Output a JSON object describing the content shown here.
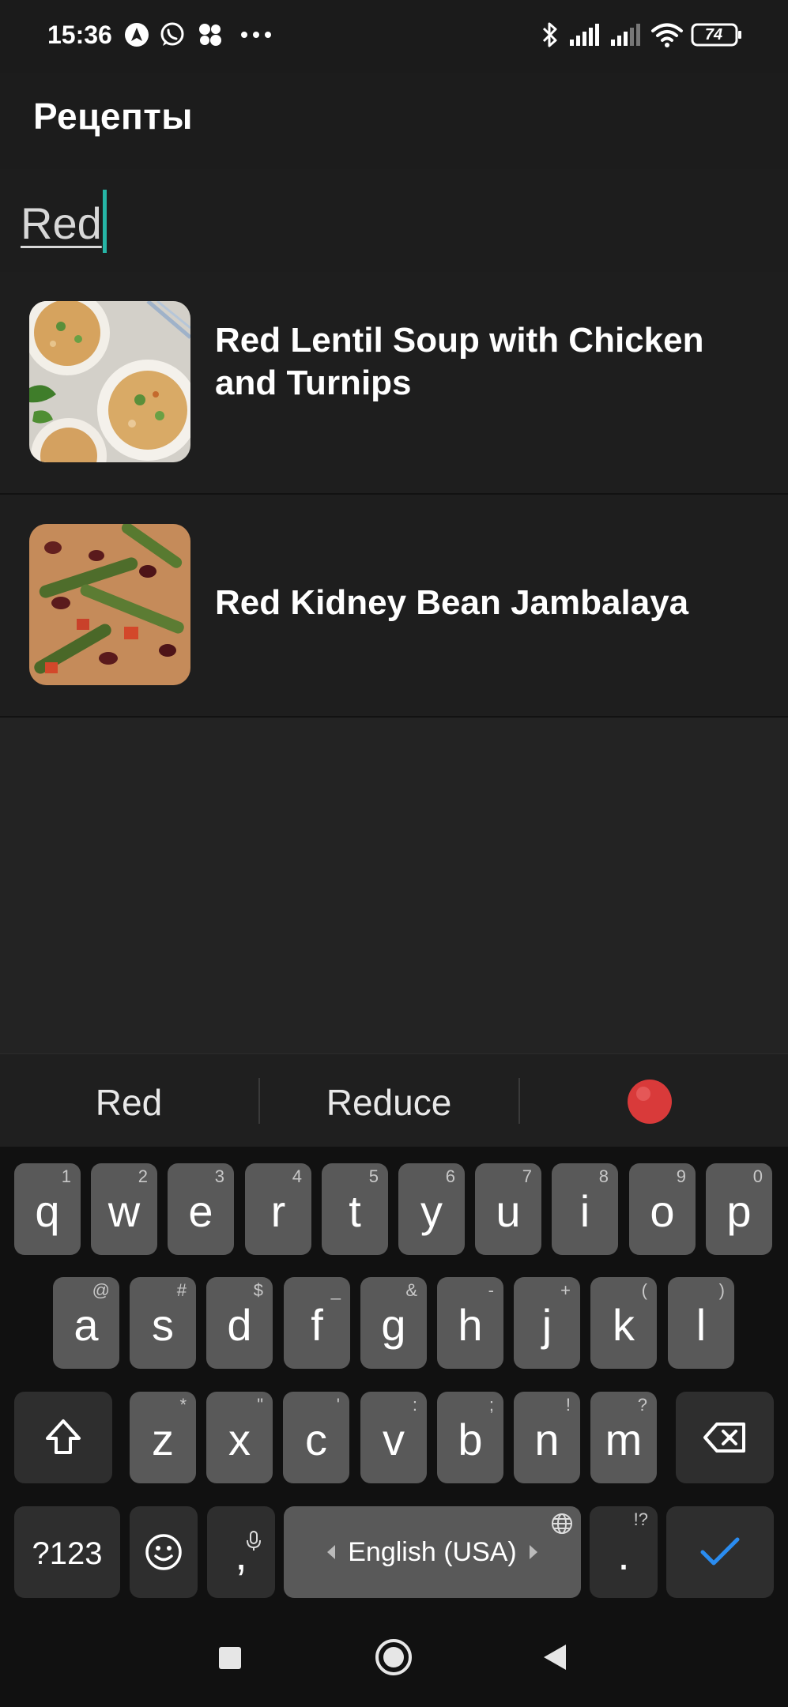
{
  "status_bar": {
    "time": "15:36",
    "battery": "74",
    "icons": [
      "navigation-icon",
      "whatsapp-icon",
      "app-icon",
      "more-icon",
      "bluetooth-icon",
      "signal-icon",
      "signal-icon-2",
      "wifi-icon",
      "battery-icon"
    ]
  },
  "app_bar": {
    "title": "Рецепты"
  },
  "search": {
    "value": "Red"
  },
  "results": [
    {
      "title": "Red Lentil Soup with Chicken and Turnips",
      "image": "lentil-soup-photo"
    },
    {
      "title": "Red Kidney Bean Jambalaya",
      "image": "jambalaya-photo"
    }
  ],
  "suggestions": {
    "word1": "Red",
    "word2": "Reduce",
    "emoji": "red-circle-emoji"
  },
  "keyboard": {
    "row1": [
      {
        "key": "q",
        "hint": "1"
      },
      {
        "key": "w",
        "hint": "2"
      },
      {
        "key": "e",
        "hint": "3"
      },
      {
        "key": "r",
        "hint": "4"
      },
      {
        "key": "t",
        "hint": "5"
      },
      {
        "key": "y",
        "hint": "6"
      },
      {
        "key": "u",
        "hint": "7"
      },
      {
        "key": "i",
        "hint": "8"
      },
      {
        "key": "o",
        "hint": "9"
      },
      {
        "key": "p",
        "hint": "0"
      }
    ],
    "row2": [
      {
        "key": "a",
        "hint": "@"
      },
      {
        "key": "s",
        "hint": "#"
      },
      {
        "key": "d",
        "hint": "$"
      },
      {
        "key": "f",
        "hint": "_"
      },
      {
        "key": "g",
        "hint": "&"
      },
      {
        "key": "h",
        "hint": "-"
      },
      {
        "key": "j",
        "hint": "+"
      },
      {
        "key": "k",
        "hint": "("
      },
      {
        "key": "l",
        "hint": ")"
      }
    ],
    "row3": [
      {
        "key": "z",
        "hint": "*"
      },
      {
        "key": "x",
        "hint": "\""
      },
      {
        "key": "c",
        "hint": "'"
      },
      {
        "key": "v",
        "hint": ":"
      },
      {
        "key": "b",
        "hint": ";"
      },
      {
        "key": "n",
        "hint": "!"
      },
      {
        "key": "m",
        "hint": "?"
      }
    ],
    "symbols_label": "?123",
    "comma": ",",
    "space_label": "English (USA)",
    "period": ".",
    "period_hint": "!?"
  },
  "colors": {
    "accent_cursor": "#26b5a6",
    "enter_check": "#2a8cf0",
    "emoji_red": "#d93a3a"
  }
}
